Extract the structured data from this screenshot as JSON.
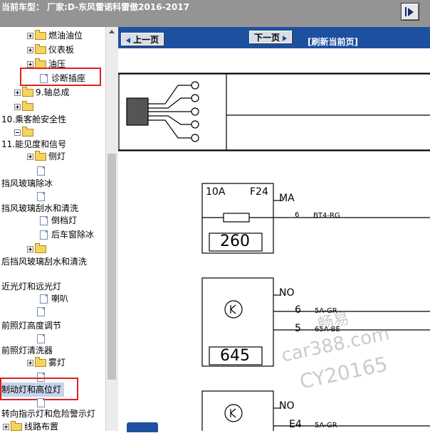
{
  "header": {
    "title": "当前车型： 厂家:D-东风雷诺科雷傲2016-2017"
  },
  "tree": {
    "items": [
      {
        "label": "燃油油位",
        "icon": "folder"
      },
      {
        "label": "仪表板",
        "icon": "folder"
      },
      {
        "label": "油压",
        "icon": "folder"
      },
      {
        "label": "诊断插座",
        "icon": "document"
      },
      {
        "label": "9.轴总成",
        "icon": "folder"
      },
      {
        "label": "",
        "icon": "folder"
      },
      {
        "label": "10.乘客舱安全性",
        "icon": "none"
      },
      {
        "label": "",
        "icon": "folder"
      },
      {
        "label": "11.能见度和信号",
        "icon": "none"
      },
      {
        "label": "侧灯",
        "icon": "folder"
      },
      {
        "label": "",
        "icon": "document"
      },
      {
        "label": "挡风玻璃除冰",
        "icon": "none"
      },
      {
        "label": "",
        "icon": "document"
      },
      {
        "label": "挡风玻璃刮水和清洗",
        "icon": "none"
      },
      {
        "label": "倒档灯",
        "icon": "document"
      },
      {
        "label": "后车窗除冰",
        "icon": "document"
      },
      {
        "label": "",
        "icon": "folder"
      },
      {
        "label": "后挡风玻璃刮水和清洗",
        "icon": "none"
      },
      {
        "label": "近光灯和远光灯",
        "icon": "none"
      },
      {
        "label": "喇叭",
        "icon": "document"
      },
      {
        "label": "",
        "icon": "document"
      },
      {
        "label": "前照灯高度调节",
        "icon": "none"
      },
      {
        "label": "",
        "icon": "document"
      },
      {
        "label": "前照灯清洗器",
        "icon": "none"
      },
      {
        "label": "雾灯",
        "icon": "folder"
      },
      {
        "label": "",
        "icon": "document"
      },
      {
        "label": "制动灯和高位灯",
        "icon": "none"
      },
      {
        "label": "",
        "icon": "document"
      },
      {
        "label": "转向指示灯和危险警示灯",
        "icon": "none"
      },
      {
        "label": "线路布置",
        "icon": "folder"
      }
    ]
  },
  "toolbar": {
    "prev_label": "上一页",
    "next_label": "下一页",
    "refresh_label": "[刷新当前页]"
  },
  "diagram": {
    "fuse": {
      "rating": "10A",
      "id": "F24",
      "number": "260",
      "connector": "MA",
      "pin": "6",
      "wire": "BT4-RG"
    },
    "relay1": {
      "connector": "NO",
      "pin_a": "6",
      "wire_a": "5A-GR",
      "pin_b": "5",
      "wire_b": "65A-BE",
      "number": "645"
    },
    "relay2": {
      "connector": "NO",
      "pin_a": "E4",
      "wire_a": "5A-GR"
    }
  },
  "watermark": {
    "line1": "畅易",
    "line2": "car388.com",
    "line3": "CY20165"
  },
  "colors": {
    "toolbar_blue": "#1e50a0",
    "titlebar_gray": "#949494",
    "highlight_red": "#e02020"
  }
}
